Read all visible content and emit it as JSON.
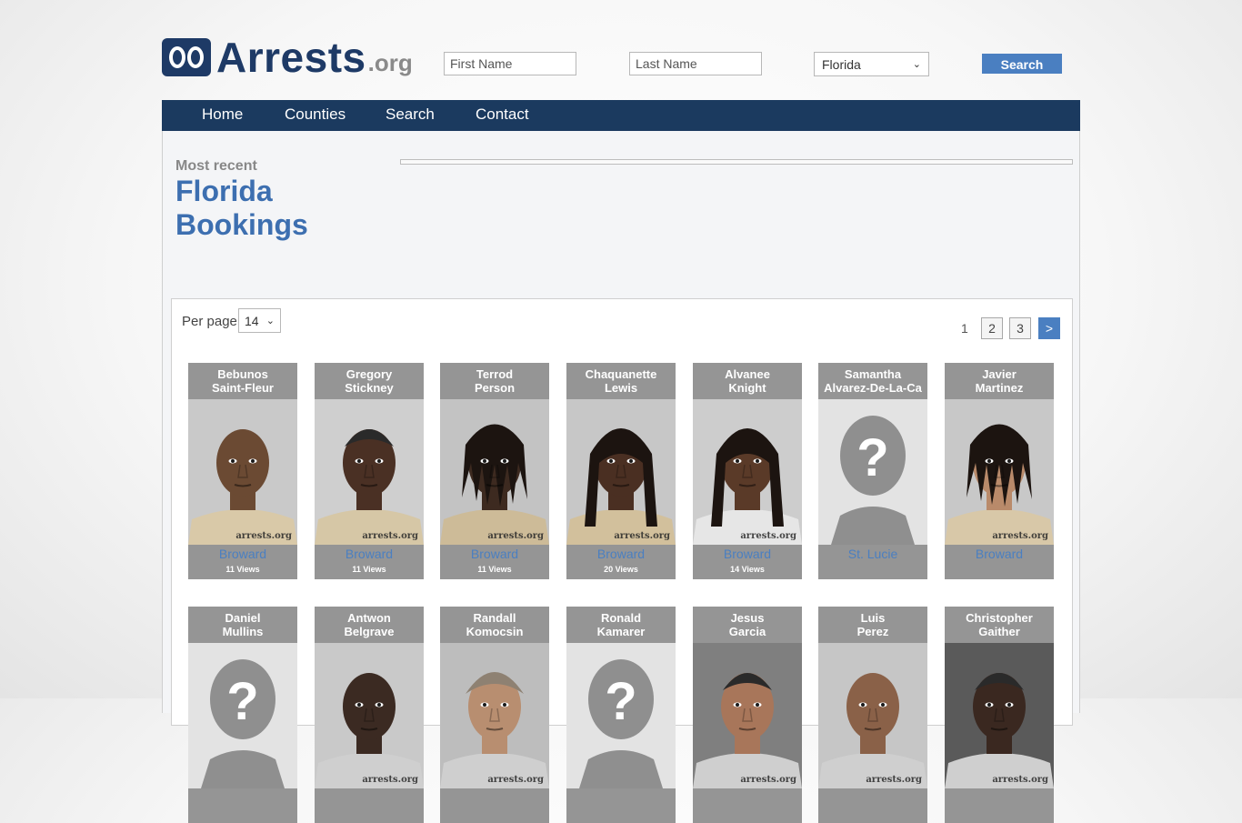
{
  "header": {
    "logo_text": "Arrests",
    "logo_tld": ".org",
    "first_name_placeholder": "First Name",
    "last_name_placeholder": "Last Name",
    "state_selected": "Florida",
    "search_label": "Search"
  },
  "nav": {
    "items": [
      "Home",
      "Counties",
      "Search",
      "Contact"
    ]
  },
  "intro": {
    "most_recent": "Most recent",
    "state": "Florida",
    "bookings": "Bookings"
  },
  "listing": {
    "per_page_label": "Per page",
    "per_page_value": "14",
    "pages": [
      "1",
      "2",
      "3"
    ],
    "next_label": ">",
    "watermark": "arrests.org"
  },
  "cards": [
    {
      "first": "Bebunos",
      "last": "Saint-Fleur",
      "county": "Broward",
      "views": "11 Views",
      "photo": "mugshot",
      "skin": "#6b4a33",
      "bg": "#c9c9c9",
      "shirt": "#d9c9a8",
      "hair": "none"
    },
    {
      "first": "Gregory",
      "last": "Stickney",
      "county": "Broward",
      "views": "11 Views",
      "photo": "mugshot",
      "skin": "#4a3024",
      "bg": "#cfcfcf",
      "shirt": "#d6c7a6",
      "hair": "short"
    },
    {
      "first": "Terrod",
      "last": "Person",
      "county": "Broward",
      "views": "11 Views",
      "photo": "mugshot",
      "skin": "#3d2a20",
      "bg": "#c3c3c3",
      "shirt": "#cdbb98",
      "hair": "dreads"
    },
    {
      "first": "Chaquanette",
      "last": "Lewis",
      "county": "Broward",
      "views": "20 Views",
      "photo": "mugshot",
      "skin": "#4a2f22",
      "bg": "#c7c7c7",
      "shirt": "#d2c09c",
      "hair": "long"
    },
    {
      "first": "Alvanee",
      "last": "Knight",
      "county": "Broward",
      "views": "14 Views",
      "photo": "mugshot",
      "skin": "#5a3a28",
      "bg": "#cdcdcd",
      "shirt": "#e6e6e6",
      "hair": "long"
    },
    {
      "first": "Samantha",
      "last": "Alvarez-De-La-Ca",
      "county": "St. Lucie",
      "views": "",
      "photo": "placeholder"
    },
    {
      "first": "Javier",
      "last": "Martinez",
      "county": "Broward",
      "views": "",
      "photo": "mugshot",
      "skin": "#b98a6a",
      "bg": "#c8c8c8",
      "shirt": "#d8c8a8",
      "hair": "dreads"
    },
    {
      "first": "Daniel",
      "last": "Mullins",
      "county": "",
      "views": "",
      "photo": "placeholder"
    },
    {
      "first": "Antwon",
      "last": "Belgrave",
      "county": "",
      "views": "",
      "photo": "mugshot",
      "skin": "#3b2a22",
      "bg": "#c9c9c9",
      "shirt": "#cfcfcf",
      "hair": "none"
    },
    {
      "first": "Randall",
      "last": "Komocsin",
      "county": "",
      "views": "",
      "photo": "mugshot",
      "skin": "#b88e70",
      "bg": "#bdbdbd",
      "shirt": "#cfcfcf",
      "hair": "grey"
    },
    {
      "first": "Ronald",
      "last": "Kamarer",
      "county": "",
      "views": "",
      "photo": "placeholder"
    },
    {
      "first": "Jesus",
      "last": "Garcia",
      "county": "",
      "views": "",
      "photo": "mugshot",
      "skin": "#a8765a",
      "bg": "#7f7f7f",
      "shirt": "#cfcfcf",
      "hair": "short"
    },
    {
      "first": "Luis",
      "last": "Perez",
      "county": "",
      "views": "",
      "photo": "mugshot",
      "skin": "#8a6148",
      "bg": "#c6c6c6",
      "shirt": "#cfcfcf",
      "hair": "none"
    },
    {
      "first": "Christopher",
      "last": "Gaither",
      "county": "",
      "views": "",
      "photo": "mugshot",
      "skin": "#3a2820",
      "bg": "#5a5a5a",
      "shirt": "#cfcfcf",
      "hair": "short"
    }
  ]
}
